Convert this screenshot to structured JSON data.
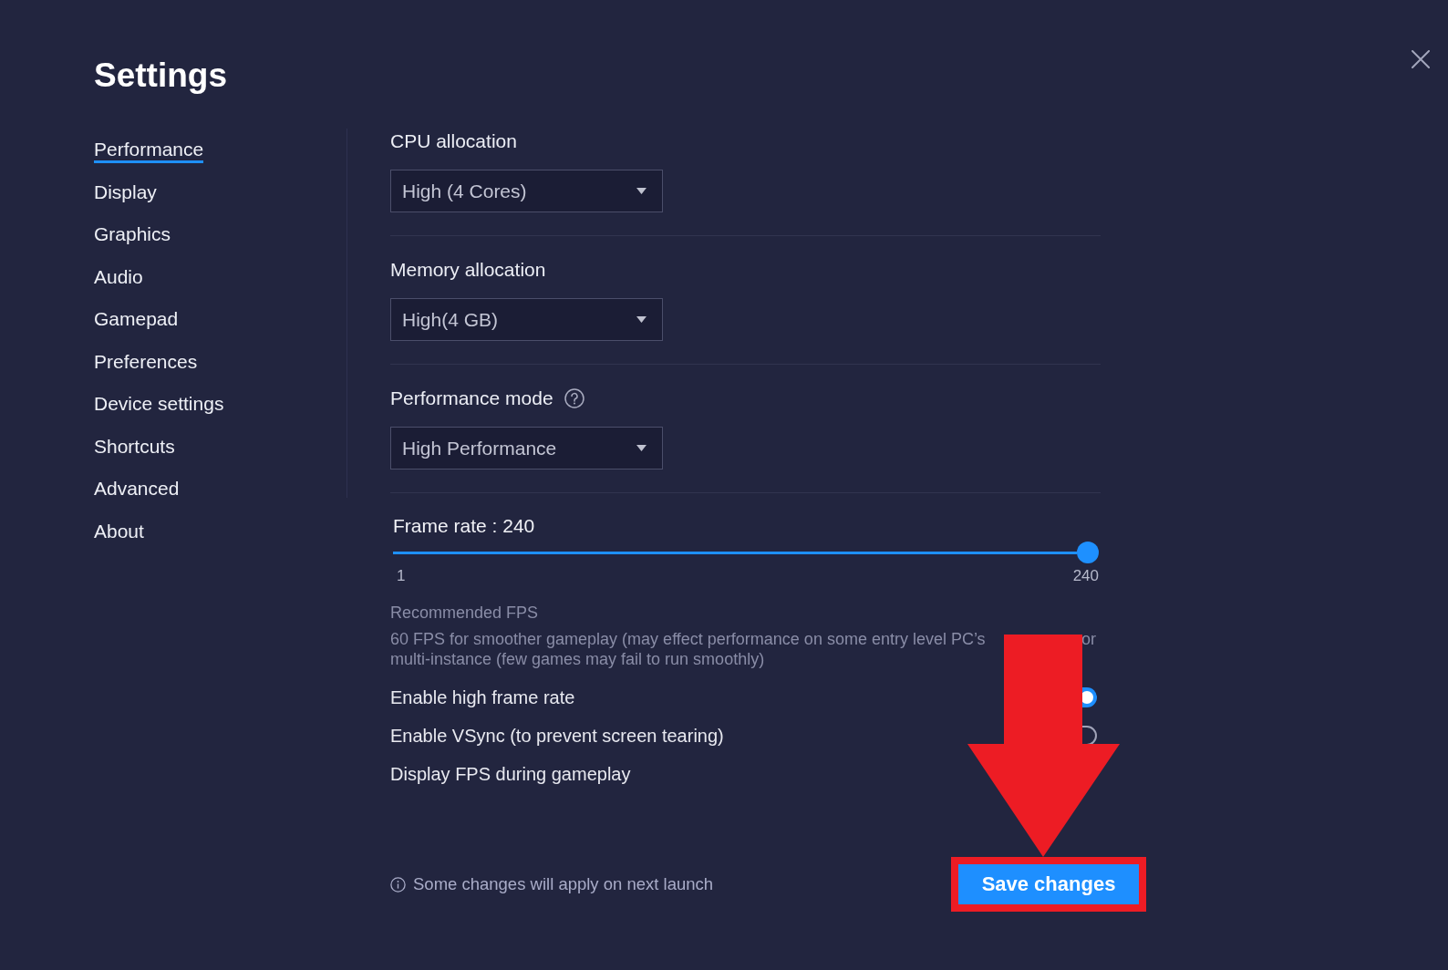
{
  "window": {
    "title": "Settings"
  },
  "sidebar": {
    "items": [
      {
        "label": "Performance",
        "selected": true
      },
      {
        "label": "Display",
        "selected": false
      },
      {
        "label": "Graphics",
        "selected": false
      },
      {
        "label": "Audio",
        "selected": false
      },
      {
        "label": "Gamepad",
        "selected": false
      },
      {
        "label": "Preferences",
        "selected": false
      },
      {
        "label": "Device settings",
        "selected": false
      },
      {
        "label": "Shortcuts",
        "selected": false
      },
      {
        "label": "Advanced",
        "selected": false
      },
      {
        "label": "About",
        "selected": false
      }
    ]
  },
  "sections": [
    {
      "label": "CPU allocation",
      "value": "High (4 Cores)",
      "help": false
    },
    {
      "label": "Memory allocation",
      "value": "High(4 GB)",
      "help": false
    },
    {
      "label": "Performance mode",
      "value": "High Performance",
      "help": true
    }
  ],
  "frame_rate": {
    "label": "Frame rate : 240",
    "level": 1,
    "min_label": "1",
    "max_label": "240"
  },
  "fps_note": {
    "title": "Recommended FPS",
    "line_1": "60 FPS for smoother gameplay (may effect performance on some entry level PC’s",
    "line_1_end": "or",
    "line_2": "multi-instance (few games may fail to run smoothly)"
  },
  "options": [
    {
      "label": "Enable high frame rate",
      "on": true
    },
    {
      "label": "Enable VSync (to prevent screen tearing)",
      "on": false
    },
    {
      "label": "Display FPS during gameplay"
    }
  ],
  "footer": {
    "notice": "Some changes will apply on next launch",
    "save_button": "Save changes"
  }
}
